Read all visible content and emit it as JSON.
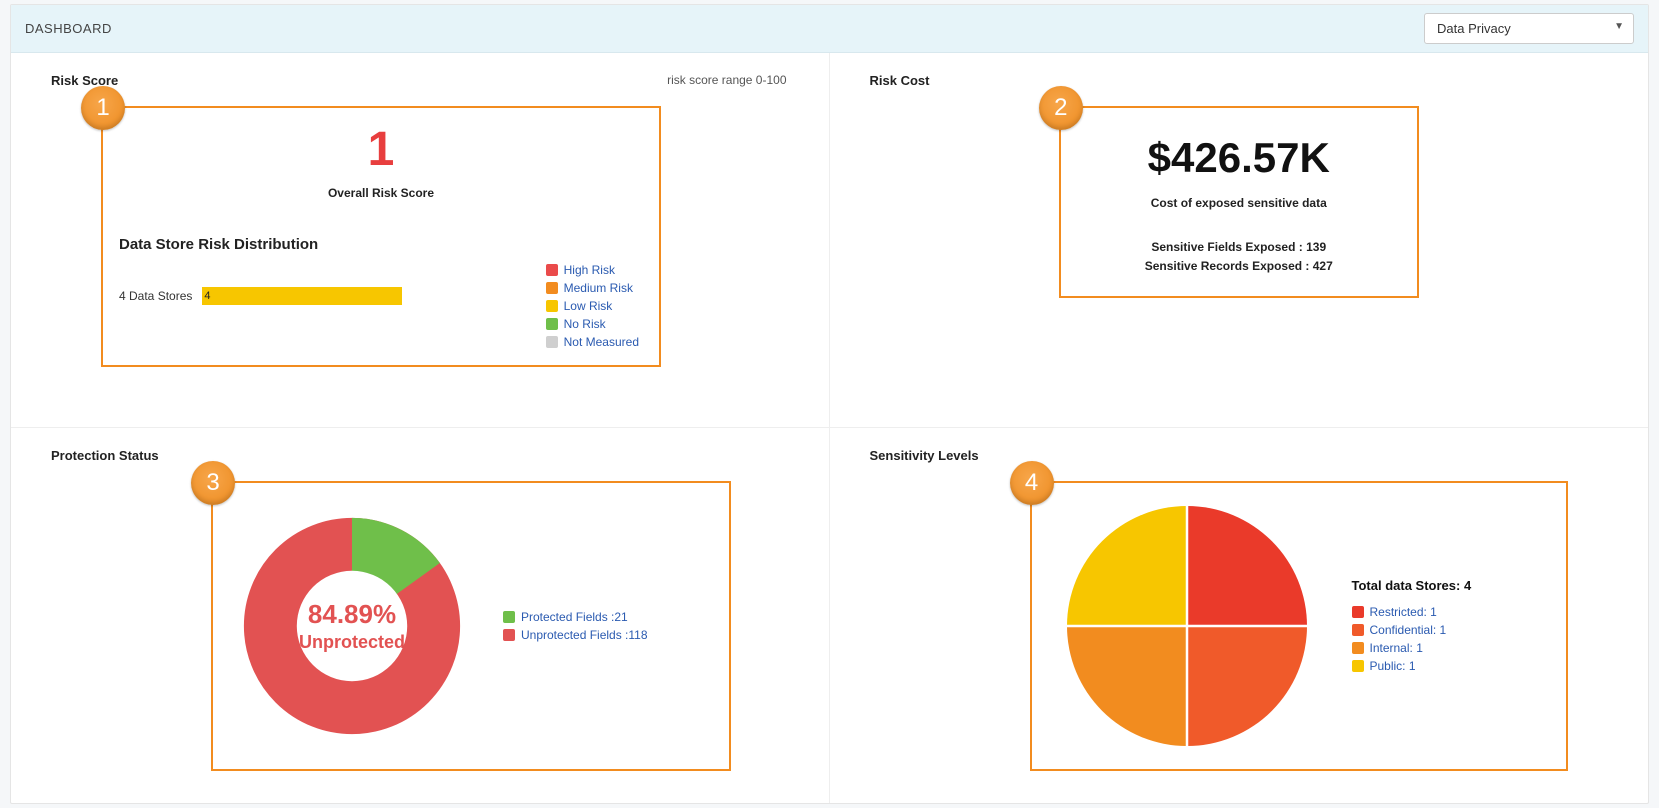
{
  "header": {
    "title": "DASHBOARD",
    "select_value": "Data Privacy",
    "select_options": [
      "Data Privacy"
    ]
  },
  "colors": {
    "orange_border": "#f28c1f",
    "high_risk": "#ea4b4b",
    "medium_risk": "#f28c1f",
    "low_risk": "#f7c600",
    "no_risk": "#6fbf4a",
    "not_measured": "#cfcfcf",
    "protected": "#6fbf4a",
    "unprotected": "#e25252",
    "restricted": "#ea3a2a",
    "confidential": "#f05a2a",
    "internal": "#f28c1f",
    "public": "#f7c600"
  },
  "risk_score": {
    "title": "Risk Score",
    "range_note": "risk score range 0-100",
    "value": "1",
    "value_label": "Overall Risk Score",
    "distribution_title": "Data Store Risk Distribution",
    "store_count_label": "4 Data Stores",
    "bar_value": "4",
    "legend": [
      {
        "label": "High Risk",
        "color": "#ea4b4b"
      },
      {
        "label": "Medium Risk",
        "color": "#f28c1f"
      },
      {
        "label": "Low Risk",
        "color": "#f7c600"
      },
      {
        "label": "No Risk",
        "color": "#6fbf4a"
      },
      {
        "label": "Not Measured",
        "color": "#cfcfcf"
      }
    ]
  },
  "risk_cost": {
    "title": "Risk Cost",
    "value": "$426.57K",
    "value_label": "Cost of exposed sensitive data",
    "fields_label": "Sensitive Fields Exposed : 139",
    "records_label": "Sensitive Records Exposed : 427"
  },
  "protection": {
    "title": "Protection Status",
    "center_pct": "84.89%",
    "center_word": "Unprotected",
    "legend": [
      {
        "label": "Protected Fields :21",
        "color": "#6fbf4a"
      },
      {
        "label": "Unprotected Fields :118",
        "color": "#e25252"
      }
    ]
  },
  "sensitivity": {
    "title": "Sensitivity Levels",
    "totals_title": "Total data Stores: 4",
    "legend": [
      {
        "label": "Restricted: 1",
        "color": "#ea3a2a"
      },
      {
        "label": "Confidential: 1",
        "color": "#f05a2a"
      },
      {
        "label": "Internal: 1",
        "color": "#f28c1f"
      },
      {
        "label": "Public: 1",
        "color": "#f7c600"
      }
    ]
  },
  "badges": {
    "b1": "1",
    "b2": "2",
    "b3": "3",
    "b4": "4"
  },
  "chart_data": [
    {
      "type": "bar",
      "title": "Data Store Risk Distribution",
      "categories": [
        "4 Data Stores"
      ],
      "series": [
        {
          "name": "High Risk",
          "values": [
            0
          ]
        },
        {
          "name": "Medium Risk",
          "values": [
            0
          ]
        },
        {
          "name": "Low Risk",
          "values": [
            4
          ]
        },
        {
          "name": "No Risk",
          "values": [
            0
          ]
        },
        {
          "name": "Not Measured",
          "values": [
            0
          ]
        }
      ],
      "xlabel": "",
      "ylabel": "",
      "ylim": [
        0,
        4
      ]
    },
    {
      "type": "pie",
      "title": "Protection Status",
      "categories": [
        "Protected Fields",
        "Unprotected Fields"
      ],
      "values": [
        21,
        118
      ],
      "annotations": [
        "84.89% Unprotected"
      ]
    },
    {
      "type": "pie",
      "title": "Sensitivity Levels",
      "categories": [
        "Restricted",
        "Confidential",
        "Internal",
        "Public"
      ],
      "values": [
        1,
        1,
        1,
        1
      ],
      "annotations": [
        "Total data Stores: 4"
      ]
    }
  ]
}
